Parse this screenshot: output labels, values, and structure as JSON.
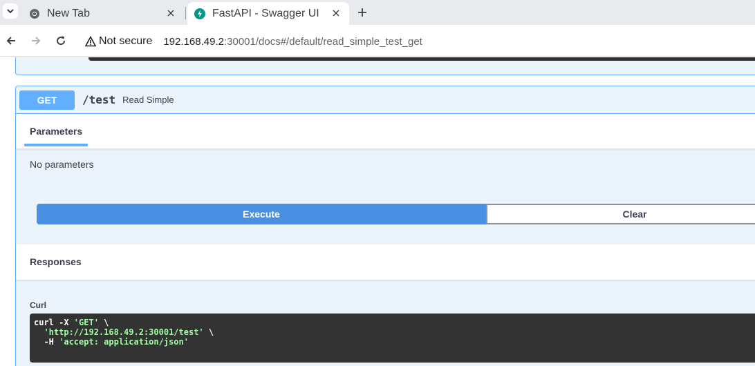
{
  "browser": {
    "tabs": [
      {
        "title": "New Tab",
        "icon": "chrome-icon",
        "active": false
      },
      {
        "title": "FastAPI - Swagger UI",
        "icon": "fastapi-icon",
        "active": true
      }
    ],
    "security_label": "Not secure",
    "url_host": "192.168.49.2",
    "url_rest": ":30001/docs#/default/read_simple_test_get"
  },
  "operation": {
    "method": "GET",
    "path": "/test",
    "summary": "Read Simple",
    "parameters_tab": "Parameters",
    "no_parameters": "No parameters",
    "execute_label": "Execute",
    "clear_label": "Clear",
    "responses_title": "Responses",
    "curl_label": "Curl",
    "curl": {
      "line1_cmd": "curl -X ",
      "line1_method": "'GET'",
      "line1_tail": " \\",
      "line2_url": "'http://192.168.49.2:30001/test'",
      "line2_tail": " \\",
      "line3_flag": "  -H ",
      "line3_header": "'accept: application/json'"
    }
  },
  "colors": {
    "get_blue": "#61affe",
    "execute_blue": "#4990e2",
    "curl_bg": "#333333",
    "curl_string": "#a2fca2"
  }
}
